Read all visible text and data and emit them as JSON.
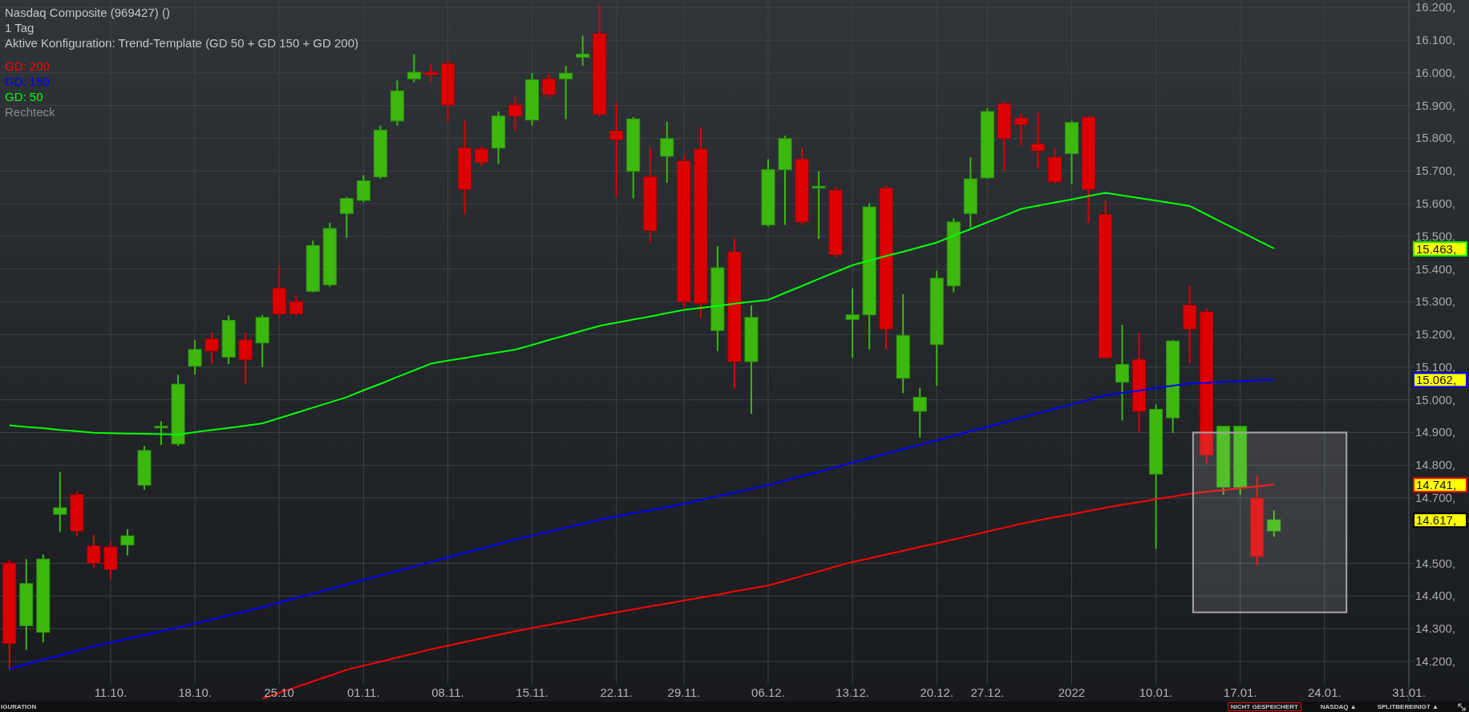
{
  "header": {
    "title": "Nasdaq Composite (969427) ()",
    "period": "1 Tag",
    "configuration": "Aktive Konfiguration: Trend-Template (GD 50 + GD 150 + GD 200)"
  },
  "chart_data": {
    "type": "candlestick",
    "grid": true,
    "ylim": [
      14.077,
      16.223
    ],
    "categories": [
      null,
      null,
      null,
      null,
      null,
      null,
      "11.10.",
      null,
      null,
      null,
      null,
      "18.10.",
      null,
      null,
      null,
      null,
      "25.10",
      null,
      null,
      null,
      null,
      "01.11.",
      null,
      null,
      null,
      null,
      "08.11.",
      null,
      null,
      null,
      null,
      "15.11.",
      null,
      null,
      null,
      null,
      "22.11.",
      null,
      null,
      null,
      "29.11.",
      null,
      null,
      null,
      null,
      "06.12.",
      null,
      null,
      null,
      null,
      "13.12.",
      null,
      null,
      null,
      null,
      "20.12.",
      null,
      null,
      "27.12.",
      null,
      null,
      null,
      null,
      "2022",
      null,
      null,
      null,
      null,
      "10.01.",
      null,
      null,
      null,
      null,
      "17.01.",
      null,
      null,
      null,
      null,
      "24.01.",
      null,
      null,
      null,
      null,
      "31.01."
    ],
    "yticks": [
      {
        "value": 16.2,
        "label": "16.200,"
      },
      {
        "value": 16.1,
        "label": "16.100,"
      },
      {
        "value": 16.0,
        "label": "16.000,"
      },
      {
        "value": 15.9,
        "label": "15.900,"
      },
      {
        "value": 15.8,
        "label": "15.800,"
      },
      {
        "value": 15.7,
        "label": "15.700,"
      },
      {
        "value": 15.6,
        "label": "15.600,"
      },
      {
        "value": 15.5,
        "label": "15.500,"
      },
      {
        "value": 15.4,
        "label": "15.400,"
      },
      {
        "value": 15.3,
        "label": "15.300,"
      },
      {
        "value": 15.2,
        "label": "15.200,"
      },
      {
        "value": 15.1,
        "label": "15.100,"
      },
      {
        "value": 15.0,
        "label": "15.000,"
      },
      {
        "value": 14.9,
        "label": "14.900,"
      },
      {
        "value": 14.8,
        "label": "14.800,"
      },
      {
        "value": 14.7,
        "label": "14.700,"
      },
      {
        "value": 14.5,
        "label": "14.500,"
      },
      {
        "value": 14.4,
        "label": "14.400,"
      },
      {
        "value": 14.3,
        "label": "14.300,"
      },
      {
        "value": 14.2,
        "label": "14.200,"
      }
    ],
    "series": [
      {
        "name": "GD: 200",
        "type": "line",
        "color": "#ff0000",
        "values": [
          null,
          null,
          null,
          null,
          null,
          null,
          null,
          null,
          null,
          null,
          null,
          null,
          null,
          null,
          null,
          14.086,
          14.104,
          14.121,
          14.139,
          14.156,
          14.174,
          14.187,
          14.199,
          14.212,
          14.224,
          14.237,
          14.248,
          14.259,
          14.27,
          14.281,
          14.292,
          14.302,
          14.312,
          14.321,
          14.331,
          14.341,
          14.35,
          14.359,
          14.368,
          14.377,
          14.386,
          14.395,
          14.404,
          14.414,
          14.423,
          14.432,
          14.446,
          14.461,
          14.475,
          14.49,
          14.504,
          14.515,
          14.527,
          14.538,
          14.55,
          14.561,
          14.573,
          14.585,
          14.597,
          14.609,
          14.621,
          14.631,
          14.641,
          14.65,
          14.66,
          14.67,
          14.679,
          14.687,
          14.696,
          14.704,
          14.713,
          14.719,
          14.724,
          14.73,
          14.735,
          14.741,
          null,
          null,
          null,
          null,
          null,
          null,
          null,
          null
        ]
      },
      {
        "name": "GD: 150",
        "type": "line",
        "color": "#0000ff",
        "values": [
          14.177,
          14.191,
          14.205,
          14.218,
          14.232,
          14.246,
          14.257,
          14.269,
          14.28,
          14.292,
          14.303,
          14.316,
          14.328,
          14.341,
          14.353,
          14.366,
          14.38,
          14.394,
          14.407,
          14.421,
          14.435,
          14.449,
          14.463,
          14.476,
          14.49,
          14.504,
          14.518,
          14.532,
          14.545,
          14.559,
          14.573,
          14.585,
          14.597,
          14.609,
          14.621,
          14.633,
          14.643,
          14.653,
          14.662,
          14.672,
          14.682,
          14.693,
          14.705,
          14.716,
          14.728,
          14.739,
          14.753,
          14.767,
          14.78,
          14.794,
          14.808,
          14.822,
          14.835,
          14.849,
          14.862,
          14.876,
          14.89,
          14.904,
          14.917,
          14.931,
          14.945,
          14.959,
          14.973,
          14.986,
          15.0,
          15.014,
          15.021,
          15.028,
          15.036,
          15.043,
          15.05,
          15.052,
          15.055,
          15.057,
          15.06,
          15.062,
          null,
          null,
          null,
          null,
          null,
          null,
          null,
          null
        ]
      },
      {
        "name": "GD: 50",
        "type": "line",
        "color": "#00ff00",
        "values": [
          14.922,
          14.917,
          14.913,
          14.908,
          14.904,
          14.899,
          14.898,
          14.897,
          14.896,
          14.895,
          14.894,
          14.901,
          14.908,
          14.914,
          14.921,
          14.928,
          14.944,
          14.96,
          14.976,
          14.992,
          15.008,
          15.029,
          15.049,
          15.07,
          15.09,
          15.111,
          15.12,
          15.128,
          15.137,
          15.145,
          15.154,
          15.168,
          15.183,
          15.197,
          15.212,
          15.226,
          15.236,
          15.246,
          15.255,
          15.265,
          15.275,
          15.281,
          15.287,
          15.294,
          15.3,
          15.306,
          15.327,
          15.348,
          15.37,
          15.391,
          15.412,
          15.426,
          15.44,
          15.453,
          15.467,
          15.481,
          15.502,
          15.522,
          15.543,
          15.563,
          15.584,
          15.594,
          15.604,
          15.613,
          15.623,
          15.633,
          15.625,
          15.617,
          15.609,
          15.601,
          15.593,
          15.567,
          15.541,
          15.515,
          15.489,
          15.463,
          null,
          null,
          null,
          null,
          null,
          null,
          null,
          null
        ]
      }
    ],
    "ohlc": [
      [
        14.501,
        14.51,
        14.172,
        14.255
      ],
      [
        14.309,
        14.513,
        14.235,
        14.438
      ],
      [
        14.289,
        14.527,
        14.258,
        14.513
      ],
      [
        14.65,
        14.779,
        14.596,
        14.67
      ],
      [
        14.71,
        14.719,
        14.584,
        14.599
      ],
      [
        14.553,
        14.587,
        14.487,
        14.501
      ],
      [
        14.55,
        14.567,
        14.452,
        14.481
      ],
      [
        14.556,
        14.604,
        14.524,
        14.584
      ],
      [
        14.739,
        14.859,
        14.725,
        14.845
      ],
      [
        14.914,
        14.934,
        14.862,
        14.919
      ],
      [
        14.865,
        15.077,
        14.859,
        15.048
      ],
      [
        15.103,
        15.183,
        15.077,
        15.154
      ],
      [
        15.186,
        15.206,
        15.109,
        15.149
      ],
      [
        15.131,
        15.258,
        15.109,
        15.243
      ],
      [
        15.183,
        15.206,
        15.048,
        15.123
      ],
      [
        15.174,
        15.26,
        15.1,
        15.252
      ],
      [
        15.341,
        15.412,
        15.252,
        15.263
      ],
      [
        15.3,
        15.321,
        15.258,
        15.263
      ],
      [
        15.332,
        15.487,
        15.329,
        15.472
      ],
      [
        15.352,
        15.541,
        15.346,
        15.524
      ],
      [
        15.57,
        15.621,
        15.495,
        15.616
      ],
      [
        15.61,
        15.687,
        15.604,
        15.67
      ],
      [
        15.682,
        15.839,
        15.676,
        15.825
      ],
      [
        15.853,
        15.977,
        15.839,
        15.945
      ],
      [
        15.982,
        16.057,
        15.971,
        16.002
      ],
      [
        16.002,
        16.028,
        15.971,
        15.994
      ],
      [
        16.028,
        16.04,
        15.851,
        15.902
      ],
      [
        15.77,
        15.853,
        15.567,
        15.644
      ],
      [
        15.767,
        15.776,
        15.713,
        15.727
      ],
      [
        15.77,
        15.882,
        15.722,
        15.868
      ],
      [
        15.902,
        15.925,
        15.822,
        15.868
      ],
      [
        15.856,
        15.999,
        15.839,
        15.979
      ],
      [
        15.982,
        15.999,
        15.925,
        15.934
      ],
      [
        15.982,
        16.022,
        15.859,
        15.999
      ],
      [
        16.048,
        16.114,
        16.022,
        16.057
      ],
      [
        16.12,
        16.209,
        15.868,
        15.873
      ],
      [
        15.822,
        15.908,
        15.621,
        15.796
      ],
      [
        15.699,
        15.865,
        15.616,
        15.859
      ],
      [
        15.682,
        15.773,
        15.481,
        15.518
      ],
      [
        15.745,
        15.851,
        15.664,
        15.799
      ],
      [
        15.73,
        15.75,
        15.283,
        15.3
      ],
      [
        15.767,
        15.833,
        15.249,
        15.295
      ],
      [
        15.212,
        15.47,
        15.149,
        15.404
      ],
      [
        15.452,
        15.495,
        15.034,
        15.117
      ],
      [
        15.117,
        15.289,
        14.957,
        15.252
      ],
      [
        15.535,
        15.736,
        15.53,
        15.704
      ],
      [
        15.704,
        15.808,
        15.535,
        15.799
      ],
      [
        15.736,
        15.77,
        15.535,
        15.544
      ],
      [
        15.65,
        15.699,
        15.492,
        15.653
      ],
      [
        15.641,
        15.65,
        15.435,
        15.444
      ],
      [
        15.246,
        15.341,
        15.129,
        15.26
      ],
      [
        15.26,
        15.601,
        15.154,
        15.59
      ],
      [
        15.647,
        15.656,
        15.154,
        15.217
      ],
      [
        15.066,
        15.323,
        15.02,
        15.197
      ],
      [
        14.965,
        15.037,
        14.885,
        15.008
      ],
      [
        15.169,
        15.395,
        15.043,
        15.372
      ],
      [
        15.349,
        15.555,
        15.329,
        15.544
      ],
      [
        15.57,
        15.742,
        15.527,
        15.676
      ],
      [
        15.679,
        15.891,
        15.676,
        15.882
      ],
      [
        15.905,
        15.914,
        15.699,
        15.799
      ],
      [
        15.862,
        15.876,
        15.779,
        15.842
      ],
      [
        15.782,
        15.879,
        15.707,
        15.762
      ],
      [
        15.742,
        15.77,
        15.661,
        15.667
      ],
      [
        15.753,
        15.853,
        15.661,
        15.848
      ],
      [
        15.865,
        15.865,
        15.541,
        15.644
      ],
      [
        15.567,
        15.61,
        15.129,
        15.129
      ],
      [
        15.054,
        15.229,
        14.937,
        15.108
      ],
      [
        15.123,
        15.206,
        14.902,
        14.965
      ],
      [
        14.773,
        14.985,
        14.544,
        14.971
      ],
      [
        14.945,
        15.183,
        14.899,
        15.18
      ],
      [
        15.289,
        15.349,
        15.111,
        15.217
      ],
      [
        15.269,
        15.28,
        14.805,
        14.831
      ],
      [
        14.733,
        14.919,
        14.71,
        14.919
      ],
      [
        14.733,
        14.919,
        14.71,
        14.919
      ],
      [
        14.699,
        14.768,
        14.493,
        14.521
      ],
      [
        14.599,
        14.662,
        14.581,
        14.633
      ],
      null,
      null,
      null,
      null,
      null,
      null,
      null,
      null
    ]
  },
  "drawings": [
    {
      "kind": "rectangle",
      "label": "Rechteck"
    }
  ],
  "price_labels": [
    {
      "text": "15.463,",
      "color": "#00ff00"
    },
    {
      "text": "15.062,",
      "color": "#0000ff"
    },
    {
      "text": "14.741,",
      "color": "#ff0000"
    },
    {
      "text": "14.617,",
      "color": "#000000"
    }
  ],
  "status_bar": {
    "left": "IGURATION",
    "items": [
      {
        "text": "NICHT GESPEICHERT",
        "kind": "alert"
      },
      {
        "text": "NASDAQ ▲",
        "kind": "menu"
      },
      {
        "text": "SPLITBEREINIGT ▲",
        "kind": "menu"
      }
    ]
  }
}
